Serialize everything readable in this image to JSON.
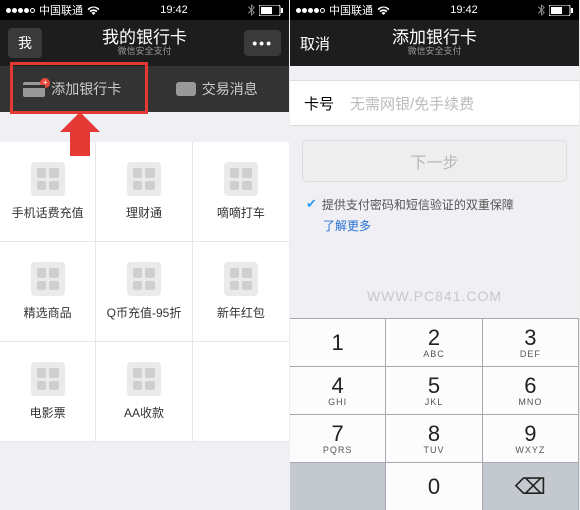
{
  "status": {
    "carrier": "中国联通",
    "time": "19:42"
  },
  "left": {
    "nav": {
      "back": "我",
      "title": "我的银行卡",
      "subtitle": "微信安全支付",
      "more": "•••"
    },
    "tabs": {
      "add": "添加银行卡",
      "trans": "交易消息"
    },
    "grid": [
      "手机话费充值",
      "理财通",
      "嘀嘀打车",
      "精选商品",
      "Q币充值-95折",
      "新年红包",
      "电影票",
      "AA收款",
      ""
    ]
  },
  "right": {
    "nav": {
      "cancel": "取消",
      "title": "添加银行卡",
      "subtitle": "微信安全支付"
    },
    "field": {
      "label": "卡号",
      "placeholder": "无需网银/免手续费"
    },
    "next": "下一步",
    "assurance": "提供支付密码和短信验证的双重保障",
    "learn_more": "了解更多",
    "watermark": "WWW.PC841.COM",
    "keypad": [
      {
        "n": "1",
        "l": ""
      },
      {
        "n": "2",
        "l": "ABC"
      },
      {
        "n": "3",
        "l": "DEF"
      },
      {
        "n": "4",
        "l": "GHI"
      },
      {
        "n": "5",
        "l": "JKL"
      },
      {
        "n": "6",
        "l": "MNO"
      },
      {
        "n": "7",
        "l": "PQRS"
      },
      {
        "n": "8",
        "l": "TUV"
      },
      {
        "n": "9",
        "l": "WXYZ"
      },
      {
        "n": "",
        "l": "",
        "gray": true
      },
      {
        "n": "0",
        "l": ""
      },
      {
        "n": "⌫",
        "l": "",
        "gray": true
      }
    ]
  }
}
